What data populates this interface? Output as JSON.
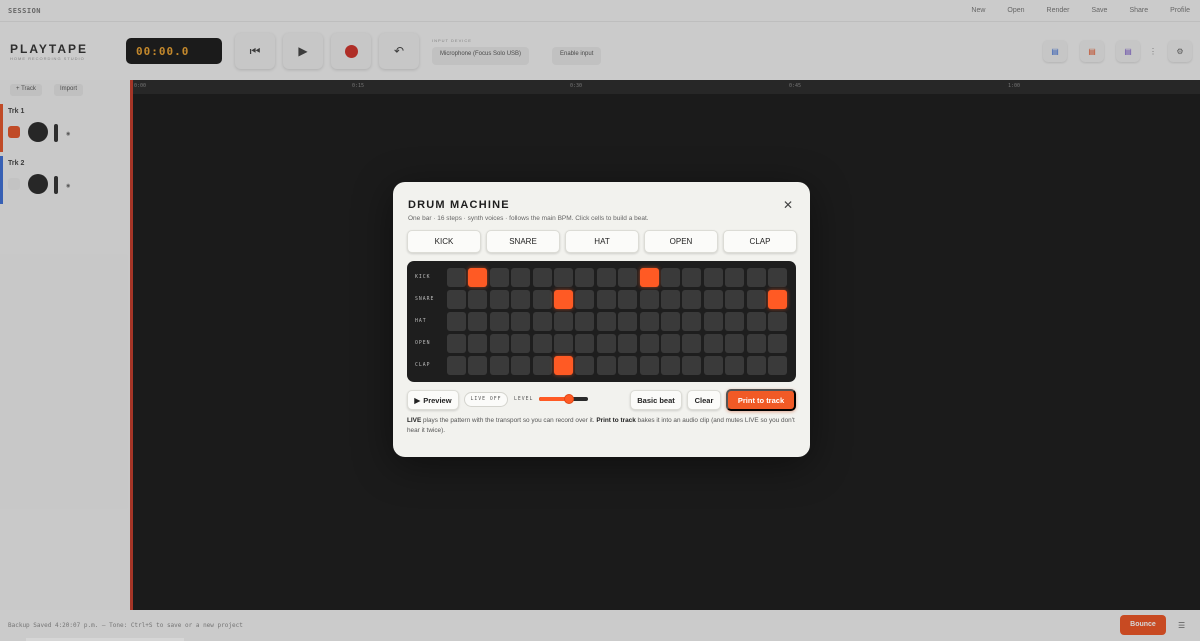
{
  "app": {
    "project_name": "SESSION",
    "menus": [
      "New",
      "Open",
      "Render",
      "Save",
      "Share",
      "Profile"
    ],
    "logo": "PLAYTAPE",
    "logo_sub": "HOME RECORDING STUDIO",
    "timecode": "00:00.0",
    "input_label": "INPUT DEVICE",
    "input_device": "Microphone (Focus Solo USB)",
    "enable_input": "Enable input",
    "add_track": "+ Track",
    "import": "Import",
    "tracks": [
      {
        "name": "Trk 1",
        "color": "#e4562a"
      },
      {
        "name": "Trk 2",
        "color": "#3d6fd6"
      }
    ],
    "ruler_ticks": [
      "0:00",
      "0:15",
      "0:30",
      "0:45",
      "1:00"
    ],
    "status_message": "Backup Saved 4:20:07 p.m. — Tone: Ctrl+S to save or a new project",
    "bounce": "Bounce"
  },
  "modal": {
    "title": "DRUM MACHINE",
    "subtitle": "One bar · 16 steps · synth voices · follows the main BPM. Click cells to build a beat.",
    "close_glyph": "✕",
    "voices": [
      "KICK",
      "SNARE",
      "HAT",
      "OPEN",
      "CLAP"
    ],
    "accent": "#ff5a24",
    "rows": [
      {
        "label": "KICK",
        "steps": [
          0,
          1,
          0,
          0,
          0,
          0,
          0,
          0,
          0,
          1,
          0,
          0,
          0,
          0,
          0,
          0
        ]
      },
      {
        "label": "SNARE",
        "steps": [
          0,
          0,
          0,
          0,
          0,
          1,
          0,
          0,
          0,
          0,
          0,
          0,
          0,
          0,
          0,
          1
        ]
      },
      {
        "label": "HAT",
        "steps": [
          0,
          0,
          0,
          0,
          0,
          0,
          0,
          0,
          0,
          0,
          0,
          0,
          0,
          0,
          0,
          0
        ]
      },
      {
        "label": "OPEN",
        "steps": [
          0,
          0,
          0,
          0,
          0,
          0,
          0,
          0,
          0,
          0,
          0,
          0,
          0,
          0,
          0,
          0
        ]
      },
      {
        "label": "CLAP",
        "steps": [
          0,
          0,
          0,
          0,
          0,
          1,
          0,
          0,
          0,
          0,
          0,
          0,
          0,
          0,
          0,
          0
        ]
      }
    ],
    "preview_label": "Preview",
    "live_label": "LIVE OFF",
    "level_label": "LEVEL",
    "level_value": 0.62,
    "basic_beat_label": "Basic beat",
    "clear_label": "Clear",
    "print_label": "Print to track",
    "help": {
      "live_word": "LIVE",
      "part1": " plays the pattern with the transport so you can record over it. ",
      "print_word": "Print to track",
      "part2": " bakes it into an audio clip (and mutes LIVE so you don't hear it twice)."
    }
  }
}
